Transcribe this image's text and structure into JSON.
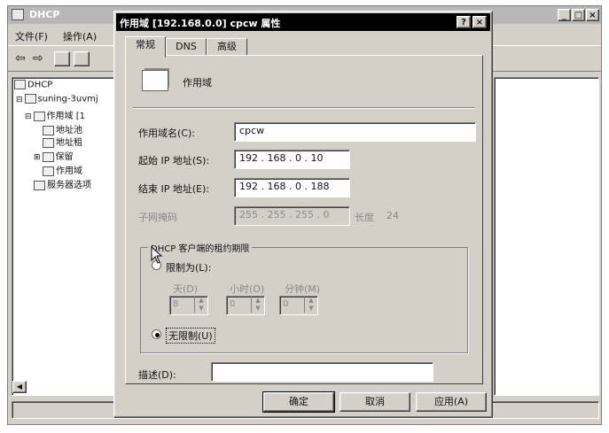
{
  "main_window": {
    "title": "DHCP",
    "menu": [
      "文件(F)",
      "操作(A)"
    ],
    "window_buttons": [
      "_",
      "□",
      "×"
    ]
  },
  "tree": {
    "items": [
      {
        "label": "DHCP",
        "icon": "dhcp-icon"
      },
      {
        "label": "suning-3uvmj",
        "icon": "server-icon"
      },
      {
        "label": "作用域 [1",
        "icon": "folder-icon"
      },
      {
        "label": "地址池",
        "icon": "address-pool-icon"
      },
      {
        "label": "地址租",
        "icon": "address-lease-icon"
      },
      {
        "label": "保留",
        "icon": "reservation-icon"
      },
      {
        "label": "作用域",
        "icon": "scope-options-icon"
      },
      {
        "label": "服务器选项",
        "icon": "server-options-icon"
      }
    ]
  },
  "dialog": {
    "title": "作用域 [192.168.0.0] cpcw 属性",
    "title_buttons": [
      "?",
      "×"
    ],
    "tabs": [
      "常规",
      "DNS",
      "高级"
    ],
    "active_tab": "常规",
    "header_label": "作用域",
    "fields": {
      "scope_name_label": "作用域名(C):",
      "scope_name_value": "cpcw",
      "start_ip_label": "起始 IP 地址(S):",
      "start_ip": [
        "192",
        "168",
        "0",
        "10"
      ],
      "end_ip_label": "结束 IP 地址(E):",
      "end_ip": [
        "192",
        "168",
        "0",
        "188"
      ],
      "subnet_label": "子网掩码",
      "subnet": [
        "255",
        "255",
        "255",
        "0"
      ],
      "length_label": "长度",
      "length_value": "24"
    },
    "lease_group": {
      "title": "DHCP 客户端的租约期限",
      "limited_label": "限制为(L):",
      "days_label": "天(D)",
      "hours_label": "小时(O)",
      "minutes_label": "分钟(M)",
      "days_value": "8",
      "hours_value": "0",
      "minutes_value": "0",
      "unlimited_label": "无限制(U)"
    },
    "description_label": "描述(D):",
    "description_value": "",
    "buttons": {
      "ok": "确定",
      "cancel": "取消",
      "apply": "应用(A)"
    }
  }
}
